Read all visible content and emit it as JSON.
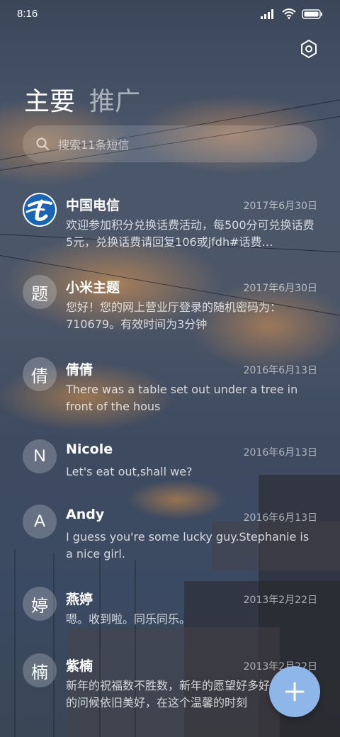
{
  "status_bar": {
    "time": "8:16"
  },
  "tabs": [
    {
      "label": "主要"
    },
    {
      "label": "推广"
    }
  ],
  "search": {
    "placeholder": "搜索11条短信"
  },
  "conversations": [
    {
      "name": "中国电信",
      "avatar": "",
      "avatar_type": "china-telecom-logo",
      "date": "2017年6月30日",
      "preview": "欢迎参加积分兑换话费活动，每500分可兑换话费5元，兑换话费请回复106或jfdh#话费…"
    },
    {
      "name": "小米主题",
      "avatar": "题",
      "date": "2017年6月30日",
      "preview": "您好！您的网上营业厅登录的随机密码为：710679。有效时间为3分钟"
    },
    {
      "name": "倩倩",
      "avatar": "倩",
      "date": "2016年6月13日",
      "preview": "There was a table set out under a tree in front of the hous"
    },
    {
      "name": "Nicole",
      "avatar": "N",
      "date": "2016年6月13日",
      "preview": "Let's eat out,shall we?"
    },
    {
      "name": "Andy",
      "avatar": "A",
      "date": "2016年6月13日",
      "preview": "I guess you're some lucky guy.Stephanie is a nice girl."
    },
    {
      "name": "燕婷",
      "avatar": "婷",
      "date": "2013年2月22日",
      "preview": "嗯。收到啦。同乐同乐。"
    },
    {
      "name": "紫楠",
      "avatar": "楠",
      "date": "2013年2月22日",
      "preview": "新年的祝福数不胜数，新年的愿望好多好多，新年的问候依旧美好，在这个温馨的时刻"
    }
  ],
  "icons": {
    "settings": "settings-hex-icon",
    "search": "search-icon",
    "compose": "plus-icon",
    "signal": "signal-icon",
    "wifi": "wifi-icon",
    "battery": "battery-icon"
  },
  "colors": {
    "fab": "#8fb6e8",
    "telecom_blue": "#1a64b4"
  }
}
